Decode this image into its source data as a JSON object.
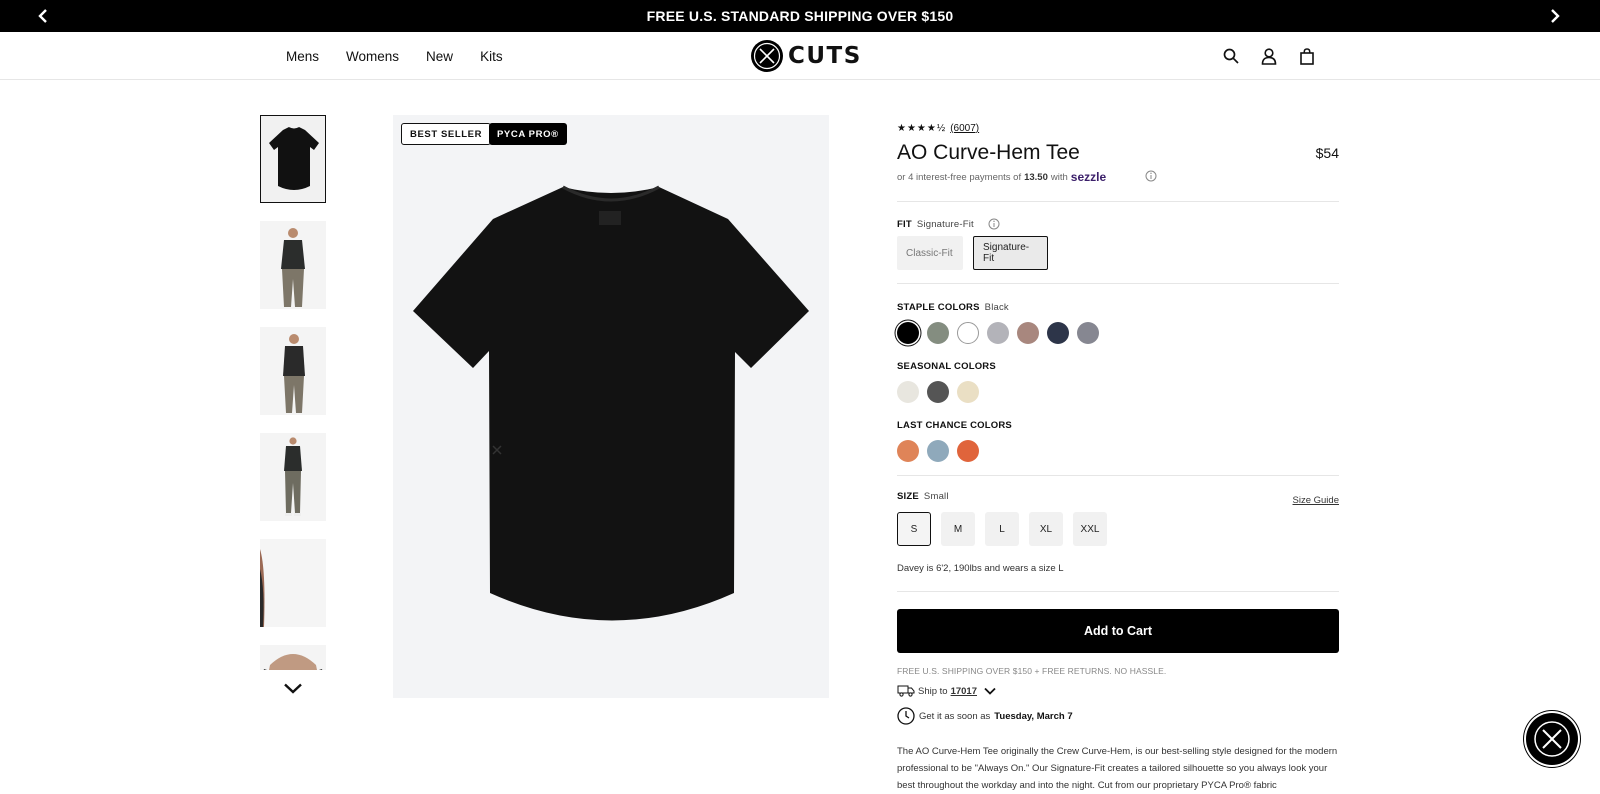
{
  "announcement": {
    "text": "FREE U.S. STANDARD SHIPPING OVER $150",
    "prev_icon": "chevron-left-icon",
    "next_icon": "chevron-right-icon"
  },
  "header": {
    "nav": [
      "Mens",
      "Womens",
      "New",
      "Kits"
    ],
    "logo_text": "CUTS",
    "icons": [
      "search-icon",
      "account-icon",
      "cart-icon"
    ]
  },
  "gallery": {
    "thumbnail_count": 6,
    "badges": {
      "best_seller": "BEST SELLER",
      "pyca": "PYCA PRO®"
    }
  },
  "product": {
    "rating_count": "(6007)",
    "stars": "★★★★½",
    "rating_value": 4.5,
    "title": "AO Curve-Hem Tee",
    "price": "$54",
    "installments": {
      "prefix": "or 4 interest-free payments of",
      "amount": "13.50",
      "with": "with",
      "provider": "sezzle"
    },
    "fit": {
      "label": "FIT",
      "selected": "Signature-Fit",
      "options": [
        "Classic-Fit",
        "Signature-Fit"
      ]
    },
    "staple_colors": {
      "label": "STAPLE COLORS",
      "selected": "Black",
      "swatches": [
        "#000000",
        "#848d80",
        "#ffffff",
        "#b3b3b9",
        "#a8877e",
        "#2d3549",
        "#868791"
      ]
    },
    "seasonal_colors": {
      "label": "SEASONAL COLORS",
      "swatches": [
        "#e8e6df",
        "#555555",
        "#eadfc4"
      ]
    },
    "last_chance_colors": {
      "label": "LAST CHANCE COLORS",
      "swatches": [
        "#df8458",
        "#8fa9bb",
        "#e0643b"
      ]
    },
    "size": {
      "label": "SIZE",
      "selected": "Small",
      "guide": "Size Guide",
      "options": [
        "S",
        "M",
        "L",
        "XL",
        "XXL"
      ]
    },
    "model_note": "Davey is 6'2, 190lbs and wears a size L",
    "add_to_cart": "Add to Cart",
    "shipping_note": "FREE U.S. SHIPPING OVER $150 + FREE RETURNS. NO HASSLE.",
    "ship_to": {
      "label": "Ship to",
      "zip": "17017"
    },
    "delivery": {
      "label": "Get it as soon as",
      "date": "Tuesday, March 7"
    },
    "description": "The AO Curve-Hem Tee originally the Crew Curve-Hem, is our best-selling style designed for the modern professional to be \"Always On.\" Our Signature-Fit creates a tailored silhouette so you always look your best throughout the workday and into the night. Cut from our proprietary PYCA Pro® fabric"
  }
}
